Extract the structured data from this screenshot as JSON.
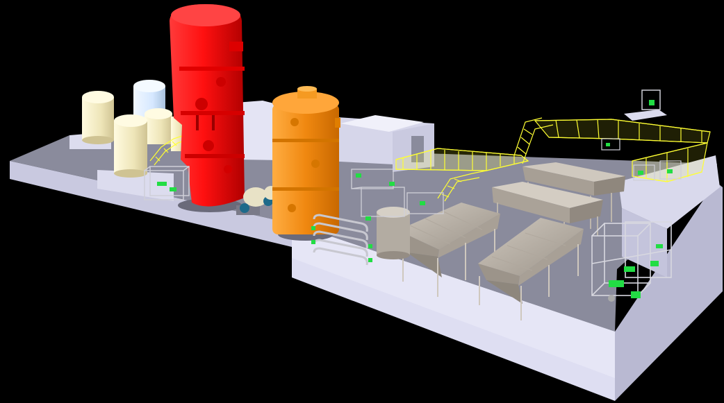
{
  "scene": {
    "background": "#000000",
    "colors": {
      "slab_top": "#8a8b9c",
      "slab_side": "#dcdcf0",
      "wall": "#e2e2f2",
      "red_column": "#ff1212",
      "orange_column": "#f08a12",
      "cream_tank": "#f1ebc6",
      "blue_tank": "#d9eaff",
      "walkway": "#ffff33",
      "hopper": "#b6aea4",
      "frame": "#cfcfd8",
      "pipe": "#22dd44",
      "motor": "#1e6a8a"
    }
  }
}
